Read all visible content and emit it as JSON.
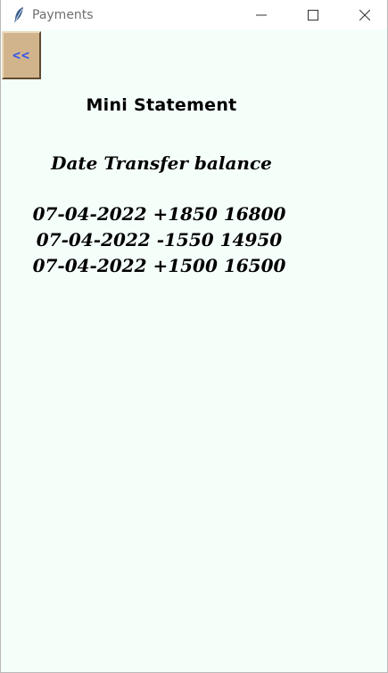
{
  "window": {
    "title": "Payments",
    "controls": {
      "minimize": "minimize",
      "maximize": "maximize",
      "close": "close"
    }
  },
  "toolbar": {
    "back_label": "<<"
  },
  "statement": {
    "title": "Mini Statement",
    "header": "Date Transfer balance",
    "rows": [
      "07-04-2022 +1850 16800",
      "07-04-2022 -1550 14950",
      "07-04-2022 +1500 16500"
    ]
  },
  "colors": {
    "background": "#f5fffa",
    "back_button": "#d2b48c",
    "back_button_text": "#3355ee"
  }
}
